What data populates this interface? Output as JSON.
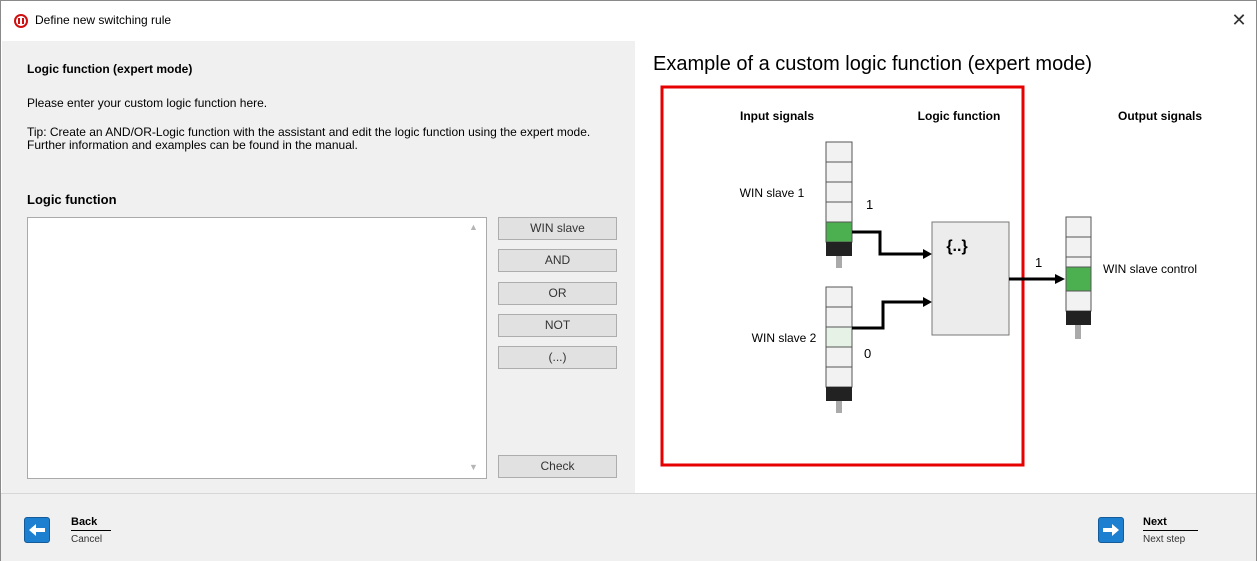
{
  "window": {
    "title": "Define new switching rule",
    "close_glyph": "✕"
  },
  "left": {
    "heading": "Logic function (expert mode)",
    "intro": "Please enter your custom logic function here.",
    "tip": "Tip: Create an AND/OR-Logic function with the assistant and edit the logic function using the expert mode. Further information and examples can be found in the manual.",
    "logic_heading": "Logic function",
    "logic_value": "",
    "buttons": {
      "win_slave": "WIN slave",
      "and": "AND",
      "or": "OR",
      "not": "NOT",
      "parens": "(...)",
      "check": "Check"
    }
  },
  "example": {
    "title": "Example of a custom logic function (expert mode)",
    "col_input": "Input signals",
    "col_logic": "Logic function",
    "col_output": "Output signals",
    "slave1_label": "WIN slave 1",
    "slave1_value": "1",
    "slave2_label": "WIN slave 2",
    "slave2_value": "0",
    "logic_box": "{..}",
    "output_value": "1",
    "output_label": "WIN slave control",
    "colors": {
      "highlight_border": "#e60000",
      "active_green": "#4caf50",
      "light_green": "#e6f2e6"
    }
  },
  "footer": {
    "back_label": "Back",
    "back_sub": "Cancel",
    "next_label": "Next",
    "next_sub": "Next step"
  }
}
